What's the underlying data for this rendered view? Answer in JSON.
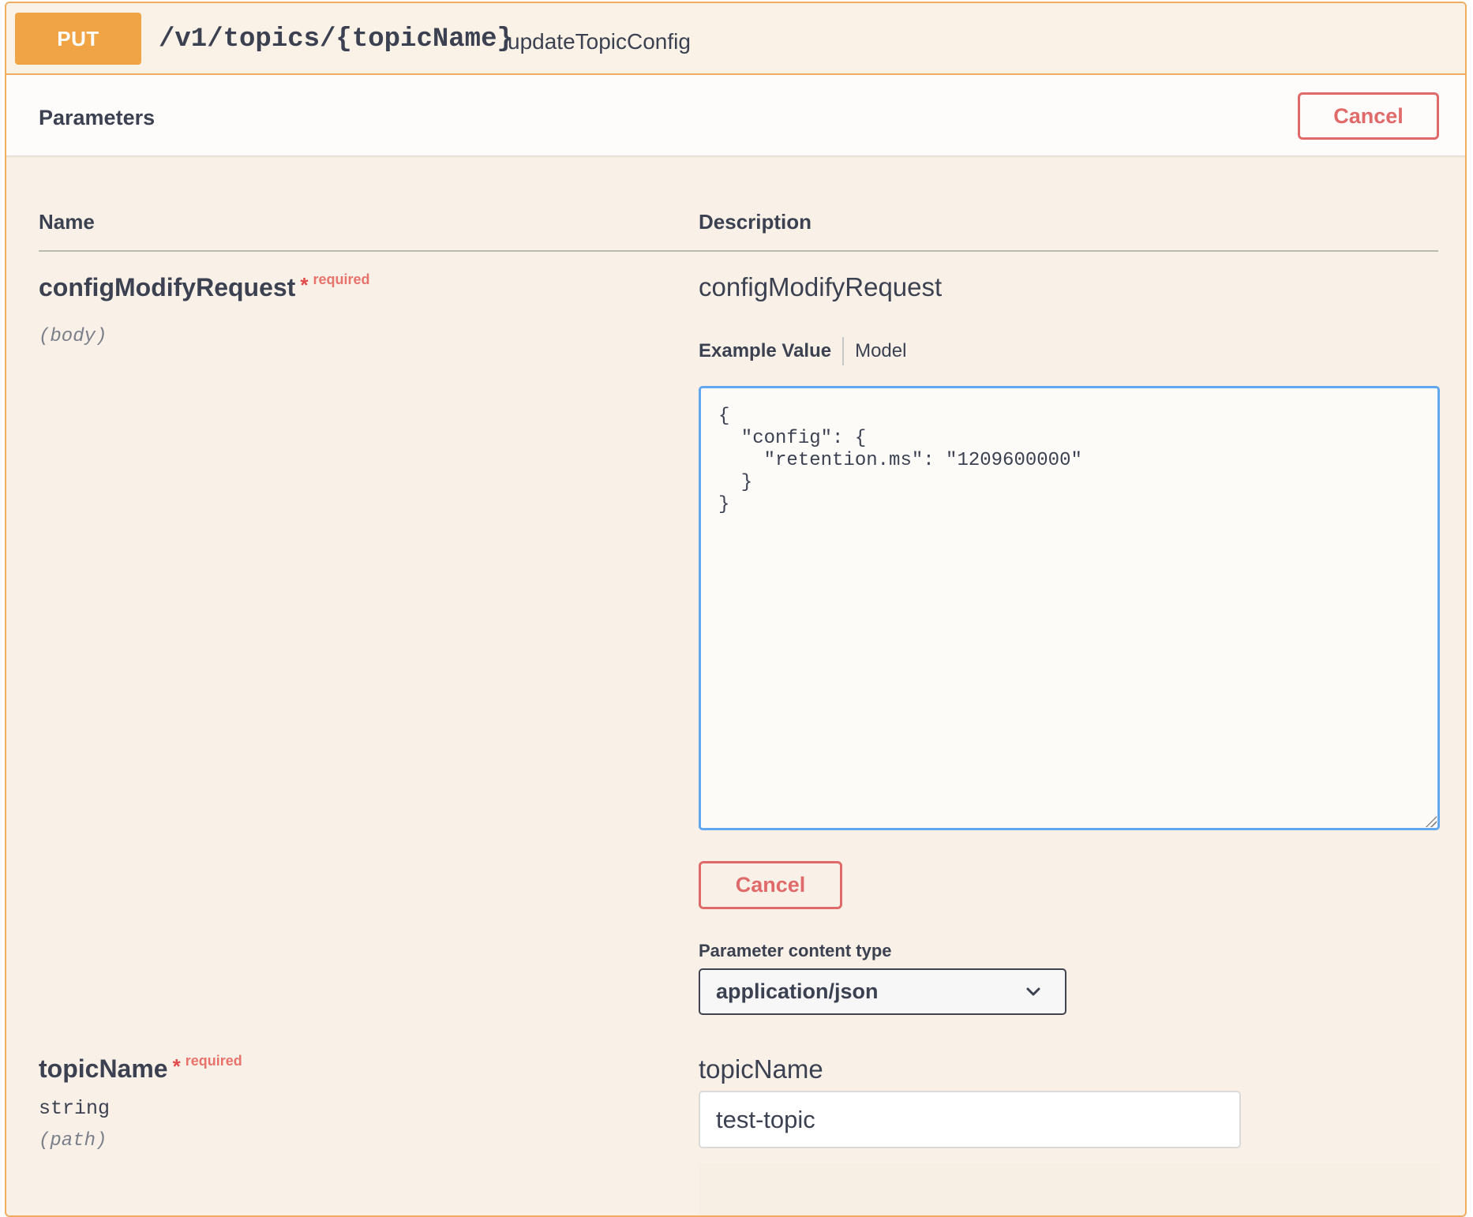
{
  "operation": {
    "method": "PUT",
    "path": "/v1/topics/{topicName}",
    "operation_id": "updateTopicConfig"
  },
  "parameters_section": {
    "title": "Parameters",
    "cancel_label": "Cancel"
  },
  "columns": {
    "name": "Name",
    "description": "Description"
  },
  "params": [
    {
      "name": "configModifyRequest",
      "star": "*",
      "required_label": "required",
      "in": "(body)",
      "description": "configModifyRequest",
      "tabs": {
        "example_value": "Example Value",
        "model": "Model"
      },
      "body_value": "{\n  \"config\": {\n    \"retention.ms\": \"1209600000\"\n  }\n}",
      "cancel_label": "Cancel",
      "content_type_label": "Parameter content type",
      "content_type_selected": "application/json"
    },
    {
      "name": "topicName",
      "star": "*",
      "required_label": "required",
      "type": "string",
      "in": "(path)",
      "description": "topicName",
      "value": "test-topic"
    }
  ],
  "colors": {
    "method_bg": "#f0a445",
    "block_border": "#f0ad62",
    "block_bg": "#f9f1e8",
    "cancel": "#e06a6a",
    "editor_focus": "#61a7ef"
  }
}
